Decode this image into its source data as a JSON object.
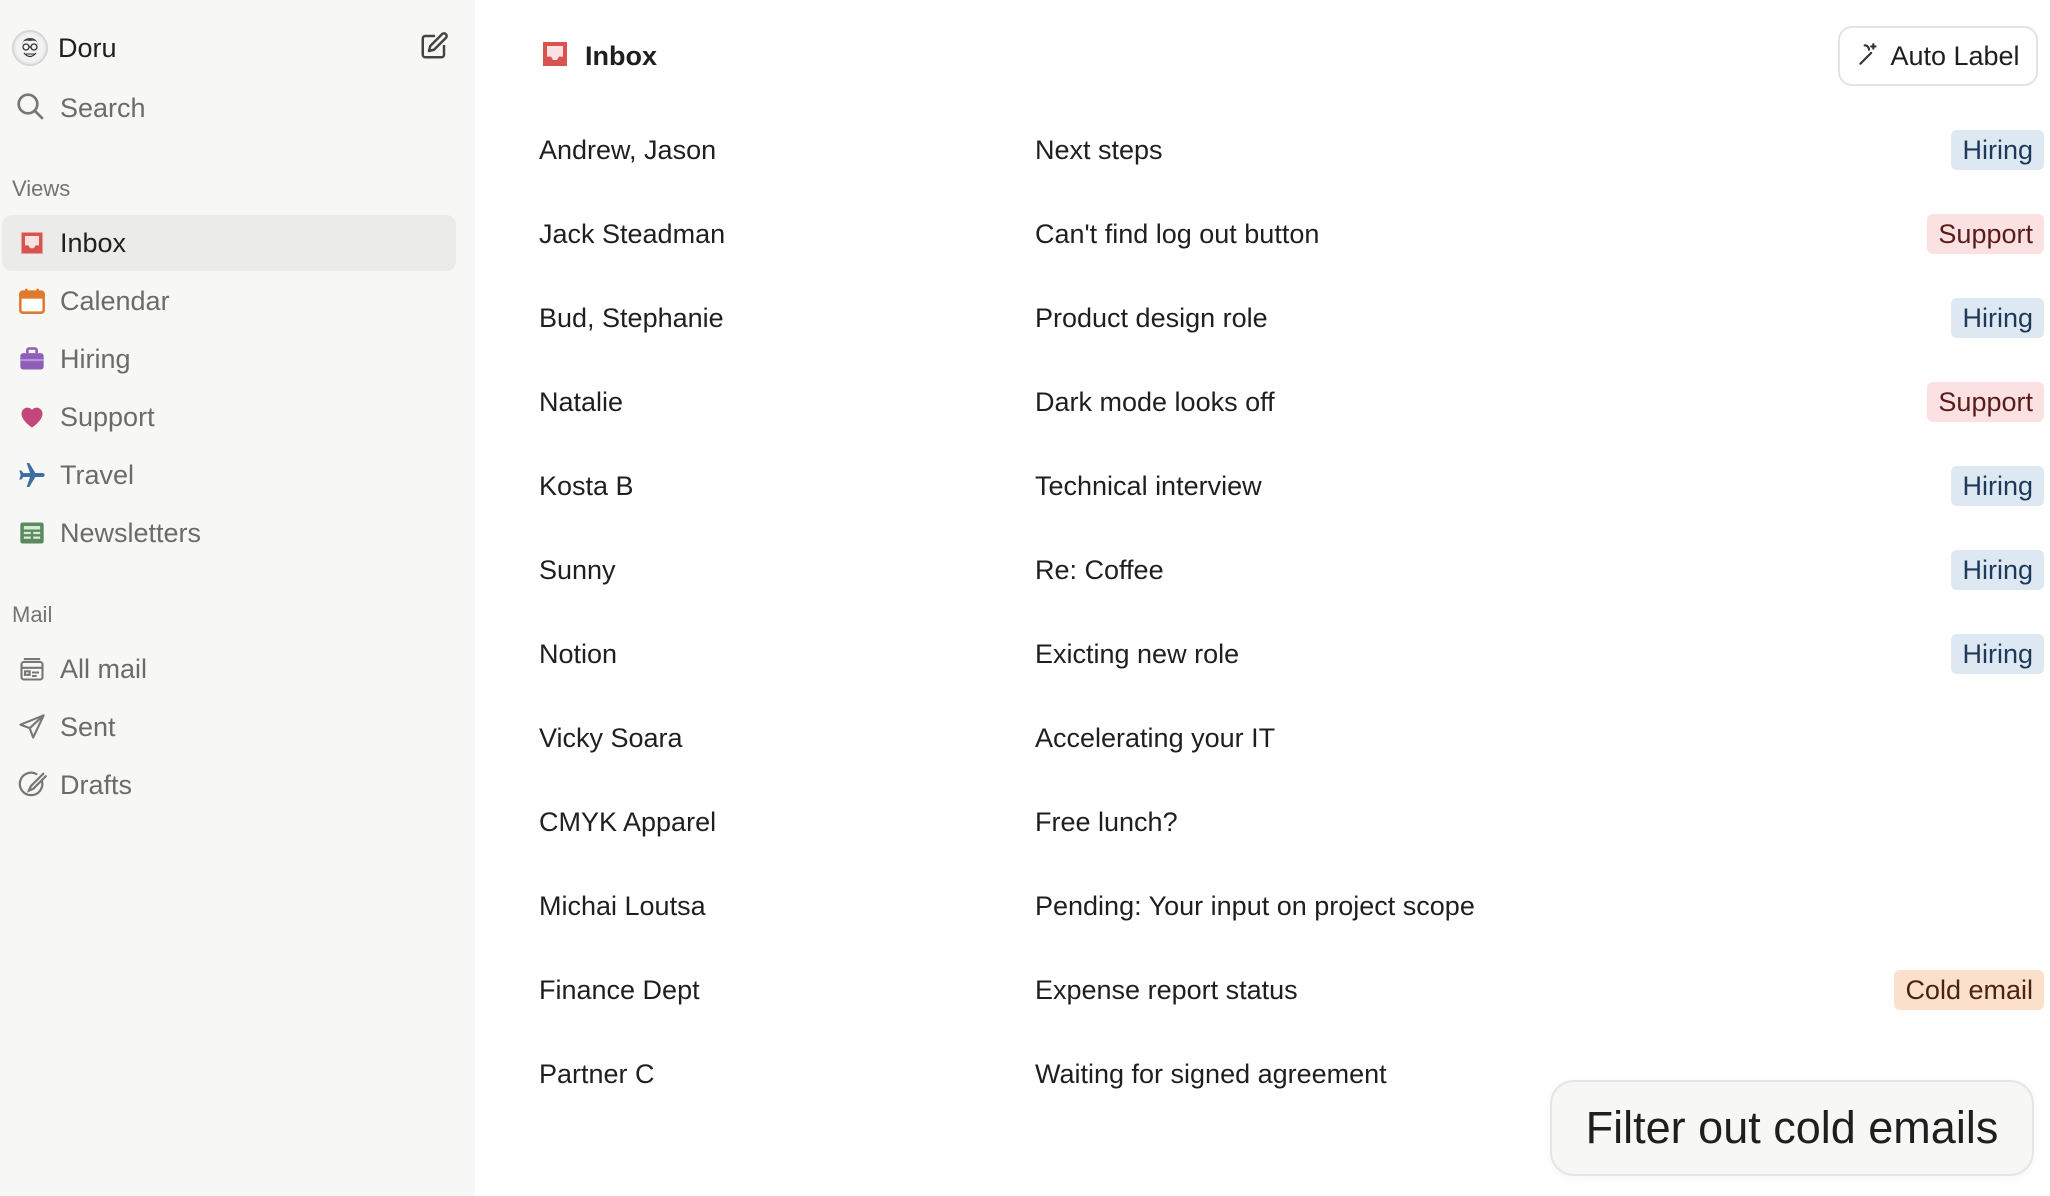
{
  "user": {
    "name": "Doru"
  },
  "search": {
    "label": "Search"
  },
  "sections": {
    "views": "Views",
    "mail": "Mail"
  },
  "views": [
    {
      "label": "Inbox",
      "icon": "inbox-icon",
      "color": "#d9534f",
      "active": true
    },
    {
      "label": "Calendar",
      "icon": "calendar-icon",
      "color": "#e07a2e"
    },
    {
      "label": "Hiring",
      "icon": "briefcase-icon",
      "color": "#8e5fb8"
    },
    {
      "label": "Support",
      "icon": "heart-icon",
      "color": "#c2467a"
    },
    {
      "label": "Travel",
      "icon": "airplane-icon",
      "color": "#3f6fa3"
    },
    {
      "label": "Newsletters",
      "icon": "newspaper-icon",
      "color": "#5a8a5e"
    }
  ],
  "mail_nav": [
    {
      "label": "All mail",
      "icon": "all-mail-icon"
    },
    {
      "label": "Sent",
      "icon": "send-icon"
    },
    {
      "label": "Drafts",
      "icon": "drafts-icon"
    }
  ],
  "header": {
    "title": "Inbox"
  },
  "auto_label": {
    "label": "Auto Label"
  },
  "tag_colors": {
    "Hiring": {
      "bg": "#dde8f3",
      "fg": "#1e3a5a"
    },
    "Support": {
      "bg": "#fbe1e1",
      "fg": "#5a1c1c"
    },
    "Cold email": {
      "bg": "#fbe0cc",
      "fg": "#4a2410"
    }
  },
  "mails": [
    {
      "sender": "Andrew, Jason",
      "subject": "Next steps",
      "tag": "Hiring"
    },
    {
      "sender": "Jack Steadman",
      "subject": "Can't find log out button",
      "tag": "Support"
    },
    {
      "sender": "Bud, Stephanie",
      "subject": "Product design role",
      "tag": "Hiring"
    },
    {
      "sender": "Natalie",
      "subject": "Dark mode looks off",
      "tag": "Support"
    },
    {
      "sender": "Kosta B",
      "subject": "Technical interview",
      "tag": "Hiring"
    },
    {
      "sender": "Sunny",
      "subject": "Re: Coffee",
      "tag": "Hiring"
    },
    {
      "sender": "Notion",
      "subject": "Exicting new role",
      "tag": "Hiring"
    },
    {
      "sender": "Vicky Soara",
      "subject": "Accelerating your IT",
      "tag": ""
    },
    {
      "sender": "CMYK Apparel",
      "subject": "Free lunch?",
      "tag": ""
    },
    {
      "sender": "Michai Loutsa",
      "subject": "Pending: Your input on project scope",
      "tag": ""
    },
    {
      "sender": "Finance Dept",
      "subject": "Expense report status",
      "tag": "Cold email"
    },
    {
      "sender": "Partner C",
      "subject": "Waiting for signed agreement",
      "tag": ""
    }
  ],
  "toast": {
    "label": "Filter out cold emails"
  }
}
